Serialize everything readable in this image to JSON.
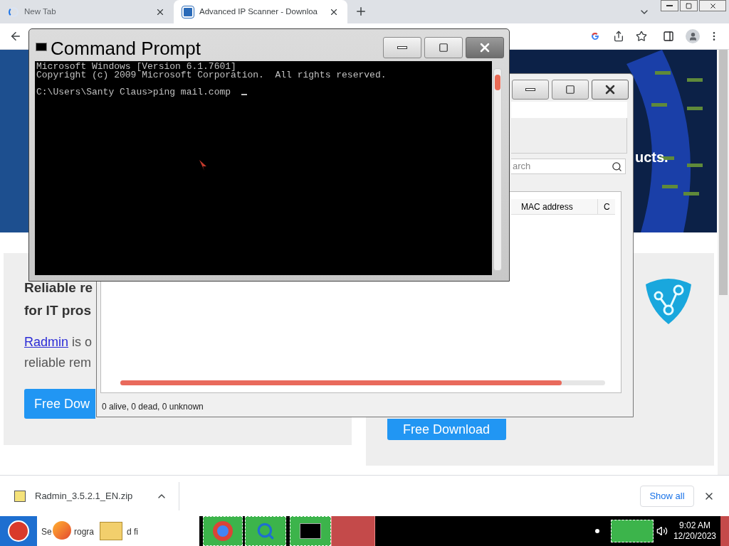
{
  "browser": {
    "tabs": [
      {
        "title": "New Tab",
        "selected": false,
        "loading": true
      },
      {
        "title": "Advanced IP Scanner - Downloa",
        "selected": true,
        "loading": false
      }
    ]
  },
  "page": {
    "hero_text": "ucts.",
    "left_card": {
      "heading_lines": [
        "Reliable re",
        "for IT pros"
      ],
      "link": "Radmin",
      "body_first": "is o",
      "body_second": "reliable rem",
      "button": "Free Dow"
    },
    "right_card": {
      "button": "Free Download"
    }
  },
  "ip_scanner": {
    "search_placeholder": "arch",
    "columns": [
      "MAC address",
      "C"
    ],
    "progress": {
      "level": 0.91
    },
    "status": "0 alive, 0 dead, 0 unknown"
  },
  "command_prompt": {
    "title": "Command Prompt",
    "header_lines": [
      "Microsoft Windows [Version 6.1.7601]",
      "Copyright (c) 2009 Microsoft Corporation.  All rights reserved."
    ],
    "prompt": "C:\\Users\\Santy Claus>ping mail.comp"
  },
  "download_bar": {
    "file": "Radmin_3.5.2.1_EN.zip",
    "show_all": "Show all"
  },
  "taskbar": {
    "search_fragments": [
      "Se",
      "rogra",
      "d fi"
    ],
    "time": "9:02 AM",
    "date": "12/20/2023"
  }
}
